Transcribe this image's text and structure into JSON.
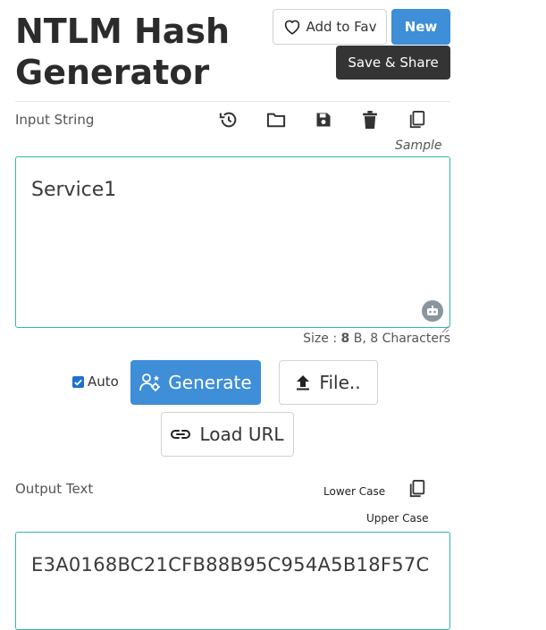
{
  "header": {
    "title": "NTLM Hash Generator",
    "fav_label": "Add to Fav",
    "new_label": "New",
    "share_label": "Save & Share"
  },
  "input": {
    "label": "Input String",
    "sample_label": "Sample",
    "value": "Service1",
    "size_prefix": "Size : ",
    "size_bytes": "8",
    "size_suffix": " B, 8 Characters",
    "toolbar_icons": [
      "history-icon",
      "folder-open-icon",
      "save-icon",
      "trash-icon",
      "copy-icon"
    ]
  },
  "actions": {
    "auto_label": "Auto",
    "auto_checked": true,
    "generate_label": "Generate",
    "file_label": "File..",
    "load_url_label": "Load URL"
  },
  "output": {
    "label": "Output Text",
    "lower_case_label": "Lower Case",
    "upper_case_label": "Upper Case",
    "value": "E3A0168BC21CFB88B95C954A5B18F57C"
  },
  "colors": {
    "primary": "#3e8ed8",
    "dark": "#343434",
    "textarea_border": "#2fb8a9"
  }
}
